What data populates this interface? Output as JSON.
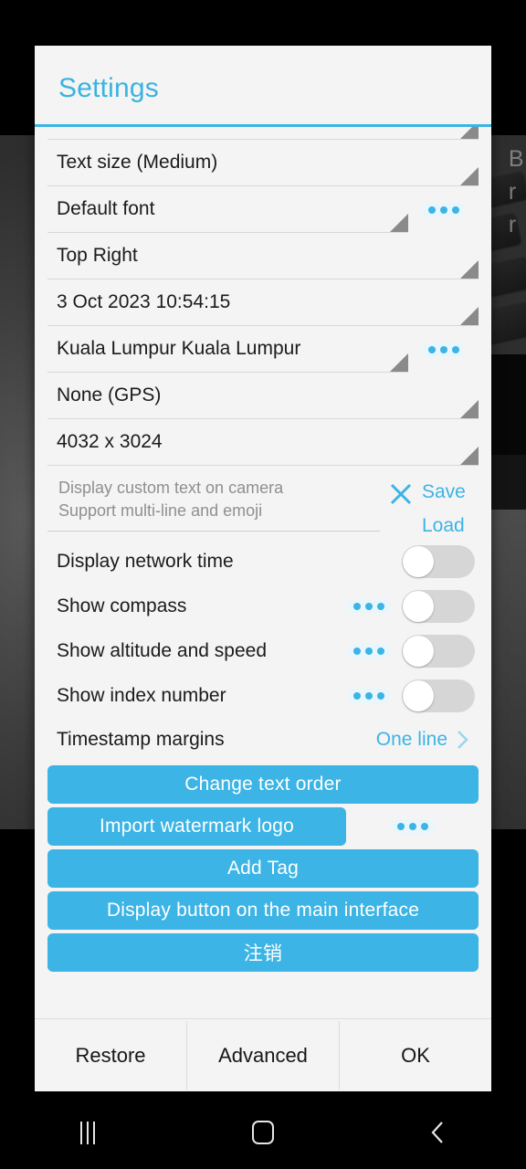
{
  "background": {
    "edge_text_lines": [
      "B",
      "r",
      "r"
    ]
  },
  "dialog": {
    "title": "Settings",
    "spinner_rows": [
      {
        "label": "",
        "clipped": true,
        "has_dots": false,
        "short": false
      },
      {
        "label": "Text size (Medium)",
        "clipped": false,
        "has_dots": false,
        "short": false
      },
      {
        "label": "Default font",
        "clipped": false,
        "has_dots": true,
        "short": true
      },
      {
        "label": "Top Right",
        "clipped": false,
        "has_dots": false,
        "short": false
      },
      {
        "label": "3 Oct 2023 10:54:15",
        "clipped": false,
        "has_dots": false,
        "short": false
      },
      {
        "label": "Kuala Lumpur Kuala Lumpur",
        "clipped": false,
        "has_dots": true,
        "short": true
      },
      {
        "label": "None (GPS)",
        "clipped": false,
        "has_dots": false,
        "short": false
      },
      {
        "label": "4032 x 3024",
        "clipped": false,
        "has_dots": false,
        "short": false
      }
    ],
    "custom_text": {
      "placeholder_line1": "Display custom text on camera",
      "placeholder_line2": "Support multi-line and emoji",
      "value": "",
      "clear_icon": "close-icon",
      "save_label": "Save",
      "load_label": "Load"
    },
    "toggles": [
      {
        "label": "Display network time",
        "state": "off",
        "has_dots": false
      },
      {
        "label": "Show compass",
        "state": "off",
        "has_dots": true
      },
      {
        "label": "Show altitude and speed",
        "state": "off",
        "has_dots": true
      },
      {
        "label": "Show index number",
        "state": "off",
        "has_dots": true
      }
    ],
    "margins_row": {
      "label": "Timestamp margins",
      "value": "One line",
      "chevron_icon": "chevron-right-icon"
    },
    "action_buttons": [
      {
        "label": "Change text order",
        "narrow": false,
        "has_dots": false
      },
      {
        "label": "Import watermark logo",
        "narrow": true,
        "has_dots": true
      },
      {
        "label": "Add Tag",
        "narrow": false,
        "has_dots": false
      },
      {
        "label": "Display button on the main interface",
        "narrow": false,
        "has_dots": false
      },
      {
        "label": "注销",
        "narrow": false,
        "has_dots": false
      }
    ],
    "footer": {
      "restore_label": "Restore",
      "advanced_label": "Advanced",
      "ok_label": "OK"
    }
  },
  "navbar": {
    "recents_icon": "recents-icon",
    "home_icon": "home-icon",
    "back_icon": "back-icon"
  },
  "colors": {
    "accent": "#3cb4e5",
    "dialog_bg": "#f4f4f4",
    "text": "#1b1b1b",
    "placeholder": "#8f8f8f",
    "switch_track": "#d6d6d6"
  }
}
